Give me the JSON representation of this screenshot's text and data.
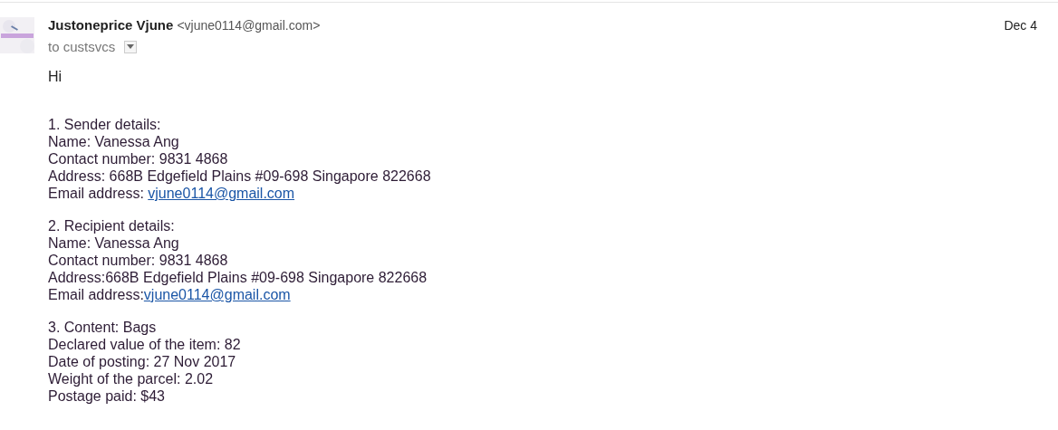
{
  "sender": {
    "name": "Justoneprice Vjune",
    "address": "<vjune0114@gmail.com>"
  },
  "recipient": "to custsvcs",
  "date": "Dec 4",
  "greeting": "Hi",
  "sections": [
    {
      "lines": [
        {
          "text": "1. Sender details:"
        },
        {
          "text": "Name: Vanessa Ang"
        },
        {
          "text": "Contact number: 9831 4868"
        },
        {
          "text": "Address: 668B Edgefield Plains #09-698 Singapore 822668"
        },
        {
          "text": "Email address: ",
          "link": "vjune0114@gmail.com"
        }
      ]
    },
    {
      "lines": [
        {
          "text": "2. Recipient details:"
        },
        {
          "text": "Name: Vanessa Ang"
        },
        {
          "text": "Contact number: 9831 4868"
        },
        {
          "text": "Address:668B Edgefield Plains #09-698 Singapore 822668"
        },
        {
          "text": "Email address:",
          "link": "vjune0114@gmail.com"
        }
      ]
    },
    {
      "lines": [
        {
          "text": "3. Content: Bags"
        },
        {
          "text": "Declared value of the item: 82"
        },
        {
          "text": "Date of posting: 27 Nov 2017"
        },
        {
          "text": "Weight of the parcel: 2.02"
        },
        {
          "text": "Postage paid: $43"
        }
      ]
    }
  ]
}
